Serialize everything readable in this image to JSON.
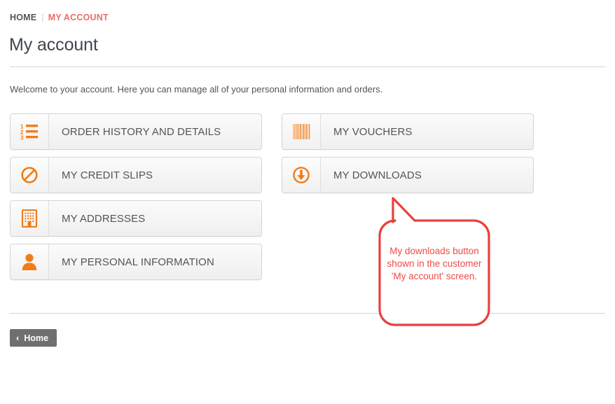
{
  "breadcrumb": {
    "home_label": "HOME",
    "separator": "|",
    "current_label": "MY ACCOUNT"
  },
  "page": {
    "title": "My account",
    "welcome": "Welcome to your account. Here you can manage all of your personal information and orders."
  },
  "account_buttons": [
    {
      "label": "ORDER HISTORY AND DETAILS",
      "icon": "ordered-list-icon",
      "column": "left",
      "row": 1
    },
    {
      "label": "MY CREDIT SLIPS",
      "icon": "ban-icon",
      "column": "left",
      "row": 2
    },
    {
      "label": "MY ADDRESSES",
      "icon": "building-icon",
      "column": "left",
      "row": 3
    },
    {
      "label": "MY PERSONAL INFORMATION",
      "icon": "user-icon",
      "column": "left",
      "row": 4
    },
    {
      "label": "MY VOUCHERS",
      "icon": "barcode-icon",
      "column": "right",
      "row": 1
    },
    {
      "label": "MY DOWNLOADS",
      "icon": "download-icon",
      "column": "right",
      "row": 2
    }
  ],
  "callout": {
    "text": "My downloads button shown in the customer 'My account' screen.",
    "color": "#ee4b46"
  },
  "footer": {
    "home_button_label": "Home",
    "home_button_chevron": "‹"
  },
  "colors": {
    "accent_orange": "#f07d19",
    "breadcrumb_current": "#ef6b68",
    "callout_red": "#ee4b46",
    "heading": "#3f4650",
    "body_text": "#555454",
    "border": "#d6d4d4",
    "home_button_bg": "#6f6f6f"
  }
}
